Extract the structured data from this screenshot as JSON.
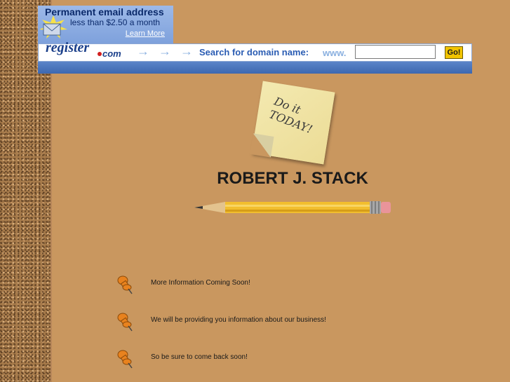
{
  "banner": {
    "promo_title": "Permanent email address",
    "promo_price": "less than $2.50 a month",
    "promo_link": "Learn More",
    "logo_text": "register",
    "logo_com": "com",
    "arrows": "→ → →",
    "search_label": "Search for domain name:",
    "www_prefix": "www.",
    "domain_value": "",
    "go_label": "Go!"
  },
  "note": {
    "line1": "Do it",
    "line2": "TODAY!"
  },
  "page": {
    "title": "ROBERT J. STACK"
  },
  "items": [
    {
      "text": "More Information Coming Soon!"
    },
    {
      "text": "We will be providing you information about our business!"
    },
    {
      "text": "So be sure to come back soon!"
    }
  ],
  "colors": {
    "background": "#c9975f",
    "accent_blue": "#2a5cb3",
    "go_button": "#f2c400",
    "pin_orange": "#e8821e"
  }
}
